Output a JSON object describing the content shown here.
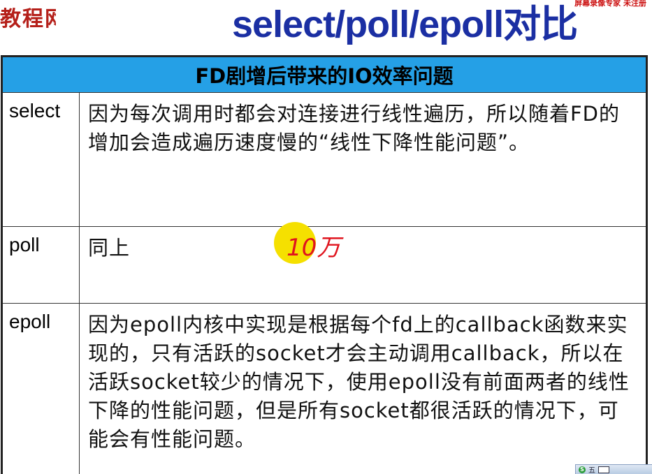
{
  "header": {
    "logo_text": "教程网",
    "credit_text": "屏幕录像专家 未注册",
    "title": "select/poll/epoll对比"
  },
  "table": {
    "heading": "FD剧增后带来的IO效率问题",
    "rows": [
      {
        "name": "select",
        "description": "因为每次调用时都会对连接进行线性遍历，所以随着FD的增加会造成遍历速度慢的“线性下降性能问题”。"
      },
      {
        "name": "poll",
        "description": "同上"
      },
      {
        "name": "epoll",
        "description": "因为epoll内核中实现是根据每个fd上的callback函数来实现的，只有活跃的socket才会主动调用callback，所以在活跃socket较少的情况下，使用epoll没有前面两者的线性下降的性能问题，但是所有socket都很活跃的情况下，可能会有性能问题。"
      }
    ]
  },
  "annotation": {
    "text": "10万",
    "highlight_color": "#f5e000",
    "ink_color": "#e0141e"
  },
  "colors": {
    "title": "#1b2fa3",
    "table_header_bg": "#25a0e6",
    "logo": "#b5201a"
  },
  "taskbar": {
    "ime_label": "五"
  }
}
